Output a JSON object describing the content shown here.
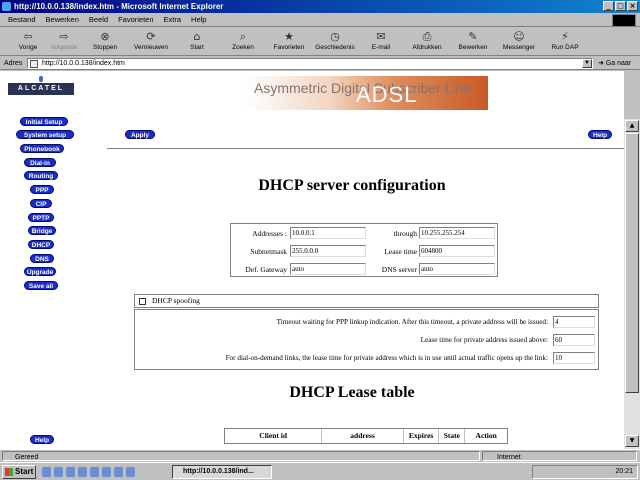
{
  "window": {
    "title": "http://10.0.0.138/index.htm - Microsoft Internet Explorer",
    "min": "_",
    "max": "□",
    "close": "×"
  },
  "menu": [
    "Bestand",
    "Bewerken",
    "Beeld",
    "Favorieten",
    "Extra",
    "Help"
  ],
  "toolbar": [
    {
      "label": "Vorige",
      "icon": "back-arrow-icon",
      "glyph": "⇦"
    },
    {
      "label": "Volgende",
      "icon": "forward-arrow-icon",
      "glyph": "⇨",
      "disabled": true
    },
    {
      "label": "Stoppen",
      "icon": "stop-icon",
      "glyph": "⊗"
    },
    {
      "label": "Vernieuwen",
      "icon": "refresh-icon",
      "glyph": "⟳"
    },
    {
      "label": "Start",
      "icon": "home-icon",
      "glyph": "⌂"
    },
    {
      "label": "Zoeken",
      "icon": "search-icon",
      "glyph": "⌕"
    },
    {
      "label": "Favorieten",
      "icon": "favorites-icon",
      "glyph": "★"
    },
    {
      "label": "Geschiedenis",
      "icon": "history-icon",
      "glyph": "◷"
    },
    {
      "label": "E-mail",
      "icon": "mail-icon",
      "glyph": "✉"
    },
    {
      "label": "Afdrukken",
      "icon": "print-icon",
      "glyph": "⎙"
    },
    {
      "label": "Bewerken",
      "icon": "edit-icon",
      "glyph": "✎"
    },
    {
      "label": "Messenger",
      "icon": "messenger-icon",
      "glyph": "☺"
    },
    {
      "label": "Run DAP",
      "icon": "dap-icon",
      "glyph": "⚡"
    }
  ],
  "address": {
    "label": "Adres",
    "value": "http://10.0.0.138/index.htm",
    "go": "Ga naar"
  },
  "nav": {
    "logo": "ALCATEL",
    "items": [
      "Initial Setup",
      "System setup",
      "Phonebook",
      "Dial-in",
      "Routing",
      "PPP",
      "CIP",
      "PPTP",
      "Bridge",
      "DHCP",
      "DNS",
      "Upgrade",
      "Save all"
    ],
    "help": "Help"
  },
  "banner": {
    "text": "Asymmetric Digital Subscriber Line",
    "adsl": "ADSL"
  },
  "main": {
    "apply": "Apply",
    "help": "Help",
    "title": "DHCP server configuration",
    "addresses_label": "Addresses :",
    "addresses_from": "10.0.0.1",
    "through_label": "through",
    "addresses_to": "10.255.255.254",
    "subnet_label": "Subnetmask",
    "subnet_value": "255.0.0.0",
    "lease_label": "Lease time",
    "lease_value": "604800",
    "gateway_label": "Def. Gateway",
    "gateway_value": "auto",
    "dns_label": "DNS server",
    "dns_value": "auto",
    "spoofing_label": "DHCP spoofing",
    "timeout_label": "Timeout waiting for PPP linkup indication. After this timeout, a private address will be issued:",
    "timeout_value": "4",
    "private_lease_label": "Lease time for private address issued above:",
    "private_lease_value": "60",
    "dod_label": "For dial-on-demand links, the lease time for private address which is in use until actual traffic opens up the link:",
    "dod_value": "10",
    "lease_table_title": "DHCP Lease table",
    "lease_columns": [
      "Client id",
      "address",
      "Expires",
      "State",
      "Action"
    ]
  },
  "status": {
    "text": "Gereed",
    "zone": "Internet"
  },
  "taskbar": {
    "start": "Start",
    "task": "http://10.0.0.138/ind...",
    "clock": "20:21"
  }
}
